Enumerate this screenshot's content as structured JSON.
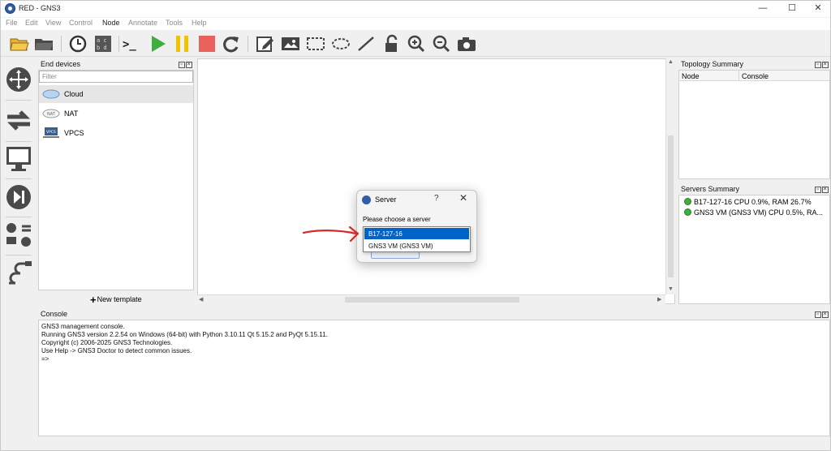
{
  "window": {
    "title": "RED - GNS3",
    "minimize": "—",
    "maximize": "☐",
    "close": "✕"
  },
  "menu": [
    {
      "label": "File"
    },
    {
      "label": "Edit"
    },
    {
      "label": "View"
    },
    {
      "label": "Control"
    },
    {
      "label": "Node"
    },
    {
      "label": "Annotate"
    },
    {
      "label": "Tools"
    },
    {
      "label": "Help"
    }
  ],
  "toolbar": {
    "icons": [
      "open-folder-icon",
      "folder-icon",
      "clock-icon",
      "snapshot-grid-icon",
      "console-icon",
      "start-icon",
      "pause-icon",
      "stop-icon",
      "reload-icon",
      "note-icon",
      "image-icon",
      "rectangle-icon",
      "ellipse-icon",
      "line-icon",
      "lock-icon",
      "zoom-in-icon",
      "zoom-out-icon",
      "camera-icon"
    ],
    "console_glyph": ">_",
    "colors": {
      "start": "#3fae3f",
      "pause": "#f2c200",
      "stop": "#e8615c"
    }
  },
  "device_rail": [
    "router-icon",
    "switch-icon",
    "end-device-icon",
    "security-device-icon",
    "all-devices-icon",
    "link-icon"
  ],
  "end_devices": {
    "title": "End devices",
    "filter_placeholder": "Filter",
    "items": [
      {
        "label": "Cloud",
        "icon": "cloud-icon",
        "selected": true
      },
      {
        "label": "NAT",
        "icon": "nat-icon",
        "selected": false
      },
      {
        "label": "VPCS",
        "icon": "vpcs-icon",
        "selected": false
      }
    ],
    "new_template": "New template"
  },
  "topology_summary": {
    "title": "Topology Summary",
    "columns": [
      "Node",
      "Console"
    ]
  },
  "servers_summary": {
    "title": "Servers Summary",
    "servers": [
      {
        "text": "B17-127-16 CPU 0.9%, RAM 26.7%",
        "status_color": "#3fae3f"
      },
      {
        "text": "GNS3 VM (GNS3 VM) CPU 0.5%, RA...",
        "status_color": "#3fae3f"
      }
    ]
  },
  "console": {
    "title": "Console",
    "lines": [
      "GNS3 management console.",
      "Running GNS3 version 2.2.54 on Windows (64-bit) with Python 3.10.11 Qt 5.15.2 and PyQt 5.15.11.",
      "Copyright (c) 2006-2025 GNS3 Technologies.",
      "Use Help -> GNS3 Doctor to detect common issues.",
      "",
      "=>"
    ]
  },
  "dialog": {
    "title": "Server",
    "help": "?",
    "close": "✕",
    "prompt": "Please choose a server",
    "options": [
      {
        "label": "B17-127-16",
        "selected": true
      },
      {
        "label": "GNS3 VM (GNS3 VM)",
        "selected": false
      }
    ]
  },
  "annotation": {
    "arrow_color": "#d42a2a"
  }
}
